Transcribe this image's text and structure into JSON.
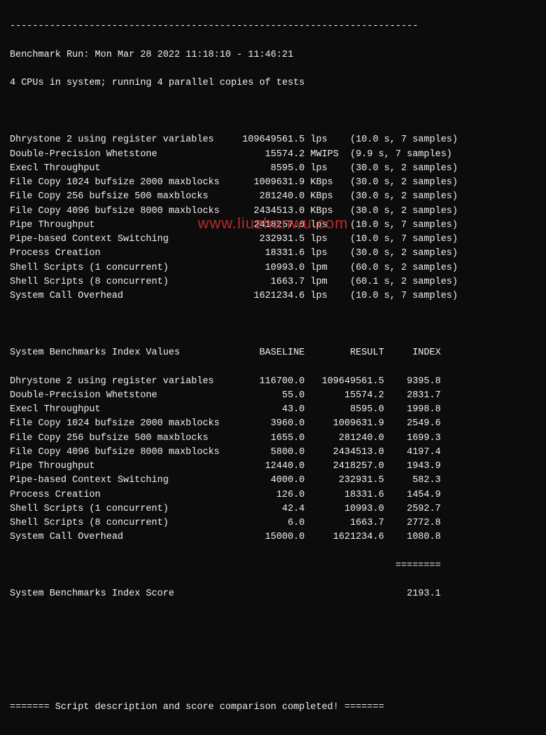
{
  "run_line": "Benchmark Run: Mon Mar 28 2022 11:18:10 - 11:46:21",
  "cpu_line": "4 CPUs in system; running 4 parallel copies of tests",
  "results": [
    {
      "name": "Dhrystone 2 using register variables",
      "value": "109649561.5",
      "unit": "lps",
      "timing": "(10.0 s, 7 samples)"
    },
    {
      "name": "Double-Precision Whetstone",
      "value": "15574.2",
      "unit": "MWIPS",
      "timing": "(9.9 s, 7 samples)"
    },
    {
      "name": "Execl Throughput",
      "value": "8595.0",
      "unit": "lps",
      "timing": "(30.0 s, 2 samples)"
    },
    {
      "name": "File Copy 1024 bufsize 2000 maxblocks",
      "value": "1009631.9",
      "unit": "KBps",
      "timing": "(30.0 s, 2 samples)"
    },
    {
      "name": "File Copy 256 bufsize 500 maxblocks",
      "value": "281240.0",
      "unit": "KBps",
      "timing": "(30.0 s, 2 samples)"
    },
    {
      "name": "File Copy 4096 bufsize 8000 maxblocks",
      "value": "2434513.0",
      "unit": "KBps",
      "timing": "(30.0 s, 2 samples)"
    },
    {
      "name": "Pipe Throughput",
      "value": "2418257.0",
      "unit": "lps",
      "timing": "(10.0 s, 7 samples)"
    },
    {
      "name": "Pipe-based Context Switching",
      "value": "232931.5",
      "unit": "lps",
      "timing": "(10.0 s, 7 samples)"
    },
    {
      "name": "Process Creation",
      "value": "18331.6",
      "unit": "lps",
      "timing": "(30.0 s, 2 samples)"
    },
    {
      "name": "Shell Scripts (1 concurrent)",
      "value": "10993.0",
      "unit": "lpm",
      "timing": "(60.0 s, 2 samples)"
    },
    {
      "name": "Shell Scripts (8 concurrent)",
      "value": "1663.7",
      "unit": "lpm",
      "timing": "(60.1 s, 2 samples)"
    },
    {
      "name": "System Call Overhead",
      "value": "1621234.6",
      "unit": "lps",
      "timing": "(10.0 s, 7 samples)"
    }
  ],
  "index_header": {
    "title": "System Benchmarks Index Values",
    "col_baseline": "BASELINE",
    "col_result": "RESULT",
    "col_index": "INDEX"
  },
  "indexes": [
    {
      "name": "Dhrystone 2 using register variables",
      "baseline": "116700.0",
      "result": "109649561.5",
      "index": "9395.8"
    },
    {
      "name": "Double-Precision Whetstone",
      "baseline": "55.0",
      "result": "15574.2",
      "index": "2831.7"
    },
    {
      "name": "Execl Throughput",
      "baseline": "43.0",
      "result": "8595.0",
      "index": "1998.8"
    },
    {
      "name": "File Copy 1024 bufsize 2000 maxblocks",
      "baseline": "3960.0",
      "result": "1009631.9",
      "index": "2549.6"
    },
    {
      "name": "File Copy 256 bufsize 500 maxblocks",
      "baseline": "1655.0",
      "result": "281240.0",
      "index": "1699.3"
    },
    {
      "name": "File Copy 4096 bufsize 8000 maxblocks",
      "baseline": "5800.0",
      "result": "2434513.0",
      "index": "4197.4"
    },
    {
      "name": "Pipe Throughput",
      "baseline": "12440.0",
      "result": "2418257.0",
      "index": "1943.9"
    },
    {
      "name": "Pipe-based Context Switching",
      "baseline": "4000.0",
      "result": "232931.5",
      "index": "582.3"
    },
    {
      "name": "Process Creation",
      "baseline": "126.0",
      "result": "18331.6",
      "index": "1454.9"
    },
    {
      "name": "Shell Scripts (1 concurrent)",
      "baseline": "42.4",
      "result": "10993.0",
      "index": "2592.7"
    },
    {
      "name": "Shell Scripts (8 concurrent)",
      "baseline": "6.0",
      "result": "1663.7",
      "index": "2772.8"
    },
    {
      "name": "System Call Overhead",
      "baseline": "15000.0",
      "result": "1621234.6",
      "index": "1080.8"
    }
  ],
  "score_label": "System Benchmarks Index Score",
  "score_value": "2193.1",
  "footer": "======= Script description and score comparison completed! =======",
  "watermark": "www.liuzhanwu.com",
  "divider": "------------------------------------------------------------------------",
  "eqshort": "========"
}
